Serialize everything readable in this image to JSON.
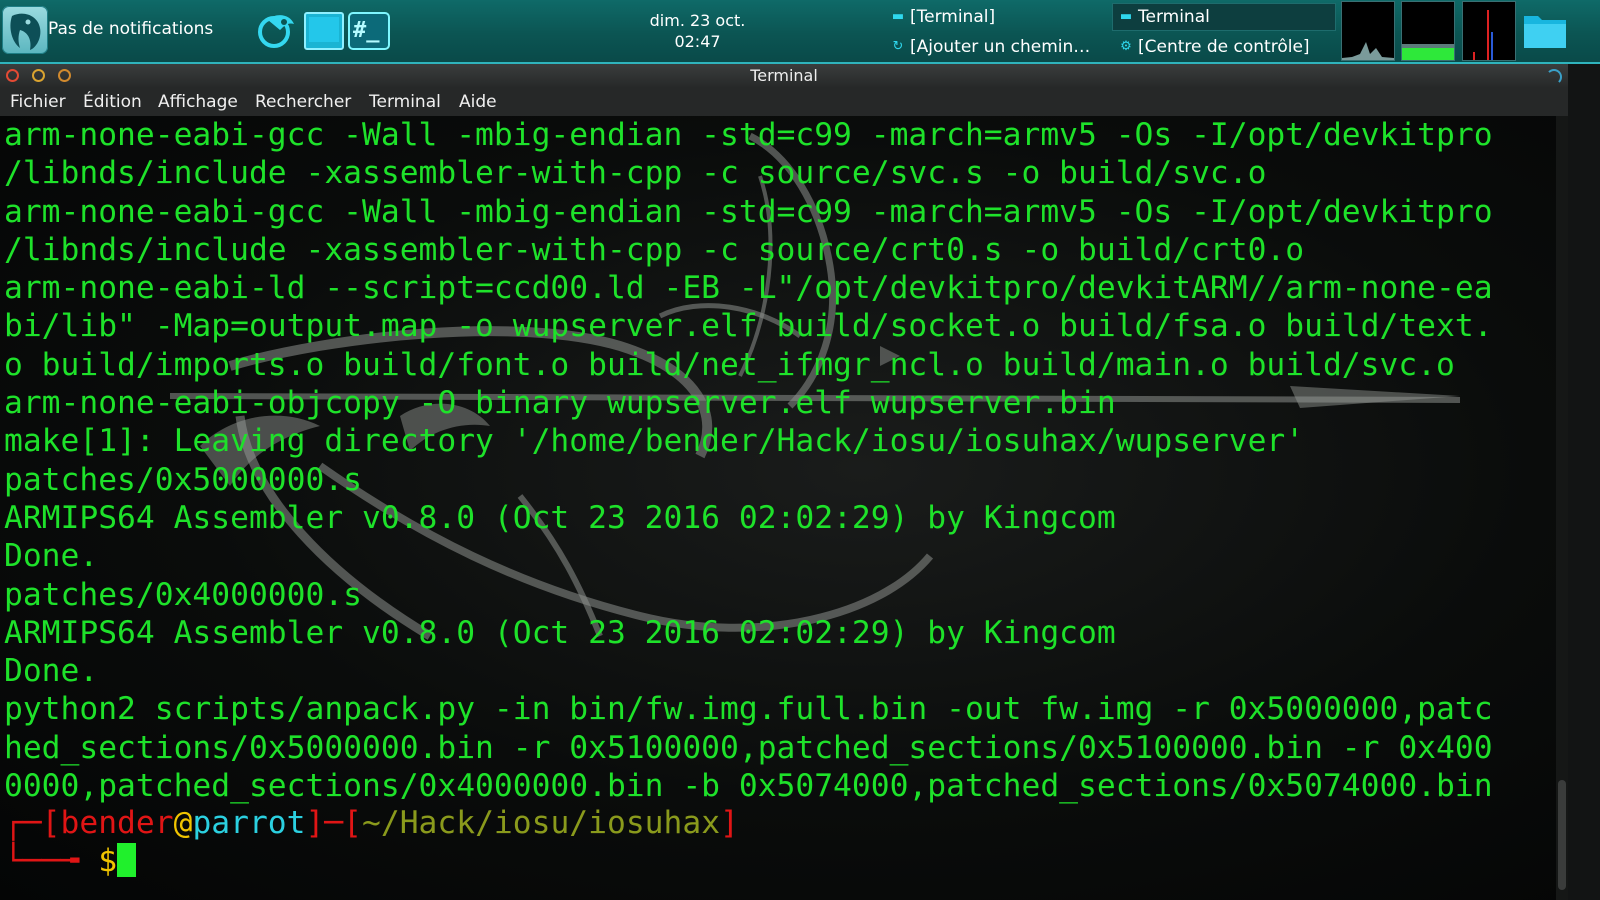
{
  "panel": {
    "notifications": "Pas de notifications",
    "clock": {
      "date": "dim. 23 oct.",
      "time": "02:47"
    },
    "tasks": [
      {
        "label": "[Terminal]"
      },
      {
        "label": "[Ajouter un chemin…"
      },
      {
        "label": "Terminal"
      },
      {
        "label": "[Centre de contrôle]"
      }
    ]
  },
  "window": {
    "title": "Terminal",
    "menu": [
      "Fichier",
      "Édition",
      "Affichage",
      "Rechercher",
      "Terminal",
      "Aide"
    ]
  },
  "terminal": {
    "lines": [
      "arm-none-eabi-gcc -Wall -mbig-endian -std=c99 -march=armv5 -Os -I/opt/devkitpro",
      "/libnds/include -xassembler-with-cpp -c source/svc.s -o build/svc.o",
      "arm-none-eabi-gcc -Wall -mbig-endian -std=c99 -march=armv5 -Os -I/opt/devkitpro",
      "/libnds/include -xassembler-with-cpp -c source/crt0.s -o build/crt0.o",
      "arm-none-eabi-ld --script=ccd00.ld -EB -L\"/opt/devkitpro/devkitARM//arm-none-ea",
      "bi/lib\" -Map=output.map -o wupserver.elf build/socket.o build/fsa.o build/text.",
      "o build/imports.o build/font.o build/net_ifmgr_ncl.o build/main.o build/svc.o",
      "arm-none-eabi-objcopy -O binary wupserver.elf wupserver.bin",
      "make[1]: Leaving directory '/home/bender/Hack/iosu/iosuhax/wupserver'",
      "patches/0x5000000.s",
      "ARMIPS64 Assembler v0.8.0 (Oct 23 2016 02:02:29) by Kingcom",
      "Done.",
      "patches/0x4000000.s",
      "ARMIPS64 Assembler v0.8.0 (Oct 23 2016 02:02:29) by Kingcom",
      "Done.",
      "python2 scripts/anpack.py -in bin/fw.img.full.bin -out fw.img -r 0x5000000,patc",
      "hed_sections/0x5000000.bin -r 0x5100000,patched_sections/0x5100000.bin -r 0x400",
      "0000,patched_sections/0x4000000.bin -b 0x5074000,patched_sections/0x5074000.bin"
    ],
    "prompt": {
      "open": "┌─[",
      "user": "bender",
      "at": "@",
      "host": "parrot",
      "sep": "]─[",
      "path": "~/Hack/iosu/iosuhax",
      "close": "]",
      "corner": "└──╼ ",
      "symbol": "$"
    }
  }
}
